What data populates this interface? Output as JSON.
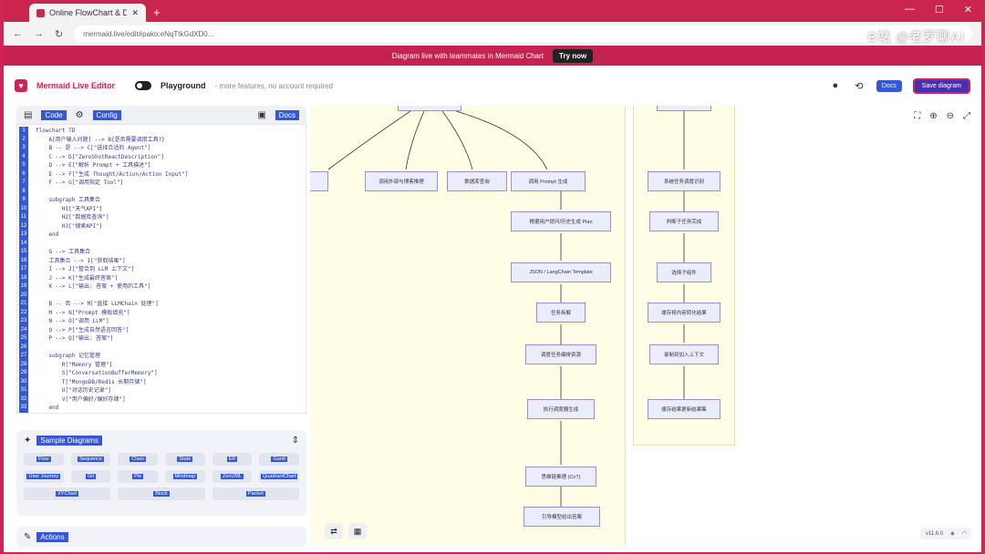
{
  "browser": {
    "tab_title": "Online FlowChart & Diagram",
    "new_tab": "+",
    "url": "mermaid.live/edit#pako:eNqTtkGdXD0...",
    "watermark": "B站 @老罗聊AI"
  },
  "promo": {
    "text": "Diagram live with teammates in Mermaid Chart",
    "button": "Try now"
  },
  "header": {
    "app_title": "Mermaid Live Editor",
    "playground_label": "Playground",
    "playground_desc": "- more features, no account required",
    "docs": "Docs",
    "save": "Save diagram"
  },
  "editor": {
    "tab_code": "Code",
    "tab_config": "Config",
    "docs": "Docs",
    "lines": [
      "flowchart TD",
      "    A[用户输入问题] --> B{是否需要调用工具?}",
      "    B -- 是 --> C[\"选择合适的 Agent\"]",
      "    C --> D[\"ZeroShotReactDescription\"]",
      "    D --> E[\"解析 Prompt + 工具描述\"]",
      "    E --> F[\"生成 Thought/Action/Action Input\"]",
      "    F --> G[\"调用指定 Tool\"]",
      "",
      "    subgraph 工具集合",
      "        H1[\"天气API\"]",
      "        H2[\"数据库查询\"]",
      "        H3[\"搜索API\"]",
      "    end",
      "",
      "    G --> 工具集合",
      "    工具集合 --> I[\"获取结果\"]",
      "    I --> J[\"整合到 LLM 上下文\"]",
      "    J --> K[\"生成最终答案\"]",
      "    K --> L[\"输出: 答案 + 使用的工具\"]",
      "",
      "    B -- 否 --> M[\"直接 LLMChain 处理\"]",
      "    M --> N[\"Prompt 模板填充\"]",
      "    N --> O[\"调用 LLM\"]",
      "    O --> P[\"生成自然语言回答\"]",
      "    P --> Q[\"输出: 答案\"]",
      "",
      "    subgraph 记忆管理",
      "        R[\"Memory 管理\"]",
      "        S[\"ConversationBufferMemory\"]",
      "        T[\"MongoDB/Redis 长期存储\"]",
      "        U[\"对话历史记录\"]",
      "        V[\"用户偏好/偏好存储\"]",
      "    end"
    ]
  },
  "samples": {
    "title": "Sample Diagrams",
    "rows": [
      [
        "Flow",
        "Sequence",
        "Class",
        "State",
        "ER",
        "Gantt"
      ],
      [
        "User Journey",
        "Git",
        "Pie",
        "Mindmap",
        "ZenUML",
        "QuadrantChart"
      ],
      [
        "XYChart",
        "Block",
        "Packet"
      ]
    ]
  },
  "actions": {
    "title": "Actions"
  },
  "diagram": {
    "nodes": [
      "调用外部与博客推理",
      "数据库查询",
      "调用 Prompt 生成",
      "根据用户提问/历史生成 Plan",
      "JSON / LangChain Template",
      "任务拆解",
      "调度任务编排资源",
      "执行调度器生成",
      "思维链推理 (CoT)",
      "引导模型给出答案",
      "系统任务调度识别",
      "判断子任务完成",
      "选择子组件",
      "缓存将内容转化结果",
      "录制到加入上下文",
      "缓存结果更新结果集"
    ]
  },
  "footer": {
    "version": "v11.6.0"
  }
}
